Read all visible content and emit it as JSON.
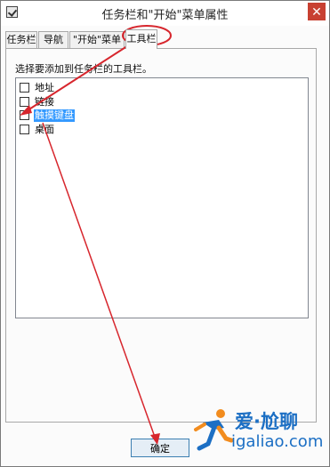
{
  "window": {
    "title": "任务栏和\"开始\"菜单属性",
    "close_label": "✕"
  },
  "tabs": [
    {
      "label": "任务栏",
      "active": false
    },
    {
      "label": "导航",
      "active": false
    },
    {
      "label": "\"开始\"菜单",
      "active": false
    },
    {
      "label": "工具栏",
      "active": true
    }
  ],
  "toolbars_panel": {
    "instruction": "选择要添加到任务栏的工具栏。",
    "items": [
      {
        "label": "地址",
        "checked": false,
        "selected": false
      },
      {
        "label": "链接",
        "checked": false,
        "selected": false
      },
      {
        "label": "触摸键盘",
        "checked": false,
        "selected": true
      },
      {
        "label": "桌面",
        "checked": false,
        "selected": false
      }
    ]
  },
  "buttons": {
    "ok_label": "确定"
  },
  "watermark": {
    "line1": "爱·尬聊",
    "line2": "igaliao.com"
  },
  "colors": {
    "annotation": "#d7262d",
    "selection": "#3399ff",
    "watermark": "#1c6fc4"
  }
}
